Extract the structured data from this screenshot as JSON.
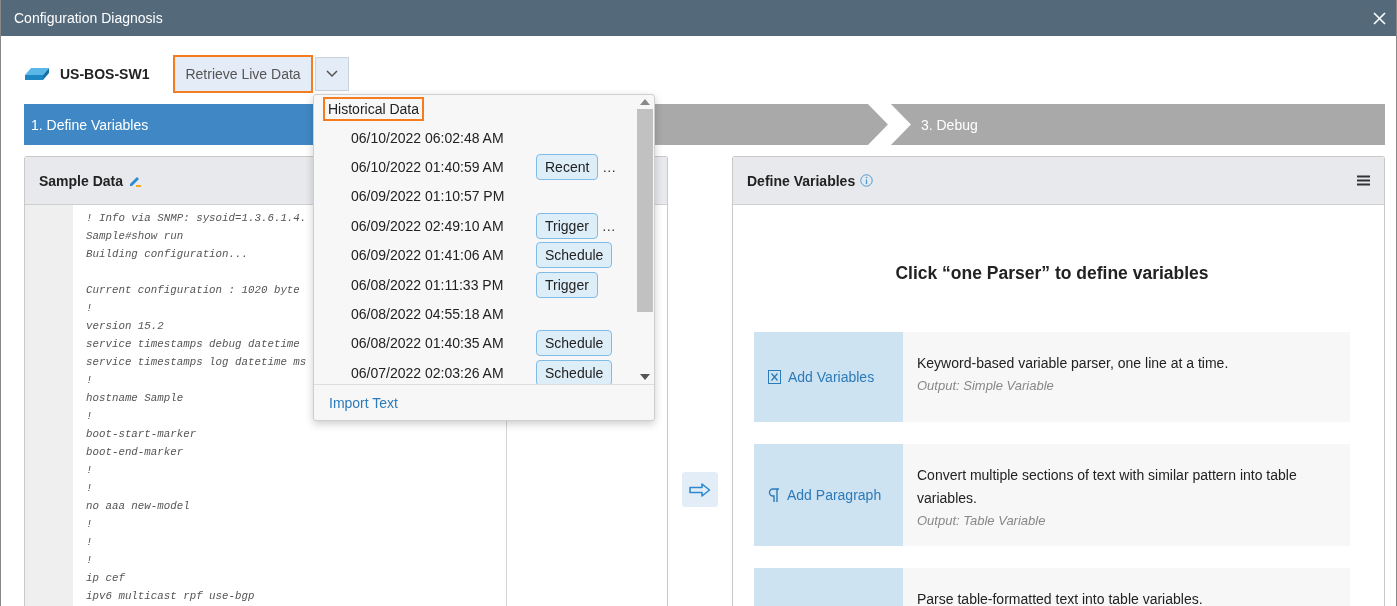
{
  "window": {
    "title": "Configuration Diagnosis"
  },
  "device": {
    "name": "US-BOS-SW1"
  },
  "retrieve_button": {
    "label": "Retrieve Live Data",
    "highlighted": true
  },
  "steps": [
    {
      "label": "1. Define Variables",
      "selected": true
    },
    {
      "selected": false
    },
    {
      "label": "3. Debug",
      "selected": false
    }
  ],
  "sample_panel": {
    "title": "Sample Data",
    "code_blocks": [
      [
        "! Info via SNMP: sysoid=1.3.6.1.4.",
        "Sample#show run",
        "Building configuration..."
      ],
      [
        "Current configuration : 1020 byte",
        "!",
        "version 15.2",
        "service timestamps debug datetime",
        "service timestamps log datetime ms",
        "!",
        "hostname Sample",
        "!",
        "boot-start-marker",
        "boot-end-marker",
        "!",
        "!",
        "no aaa new-model",
        "!",
        "!",
        "!",
        "ip cef",
        "ipv6 multicast rpf use-bgp"
      ]
    ]
  },
  "define_panel": {
    "title": "Define Variables",
    "headline": "Click “one Parser” to define variables",
    "parsers": [
      {
        "kind": "variables",
        "label": "Add Variables",
        "description": "Keyword-based variable parser, one line at a time.",
        "output": "Output: Simple Variable"
      },
      {
        "kind": "paragraph",
        "label": "Add Paragraph",
        "description": "Convert multiple sections of text with similar pattern into table variables.",
        "output": "Output: Table Variable"
      },
      {
        "kind": "table",
        "description": "Parse table-formatted text into table variables."
      }
    ]
  },
  "dropdown": {
    "header": {
      "label": "Historical Data",
      "highlighted": true
    },
    "items": [
      {
        "time": "06/10/2022 06:02:48 AM"
      },
      {
        "time": "06/10/2022 01:40:59 AM",
        "tag": "Recent",
        "more": "…"
      },
      {
        "time": "06/09/2022 01:10:57 PM"
      },
      {
        "time": "06/09/2022 02:49:10 AM",
        "tag": "Trigger",
        "more": "…"
      },
      {
        "time": "06/09/2022 01:41:06 AM",
        "tag": "Schedule"
      },
      {
        "time": "06/08/2022 01:11:33 PM",
        "tag": "Trigger"
      },
      {
        "time": "06/08/2022 04:55:18 AM"
      },
      {
        "time": "06/08/2022 01:40:35 AM",
        "tag": "Schedule"
      },
      {
        "time": "06/07/2022 02:03:26 AM",
        "tag": "Schedule"
      }
    ],
    "footer": "Import Text"
  }
}
